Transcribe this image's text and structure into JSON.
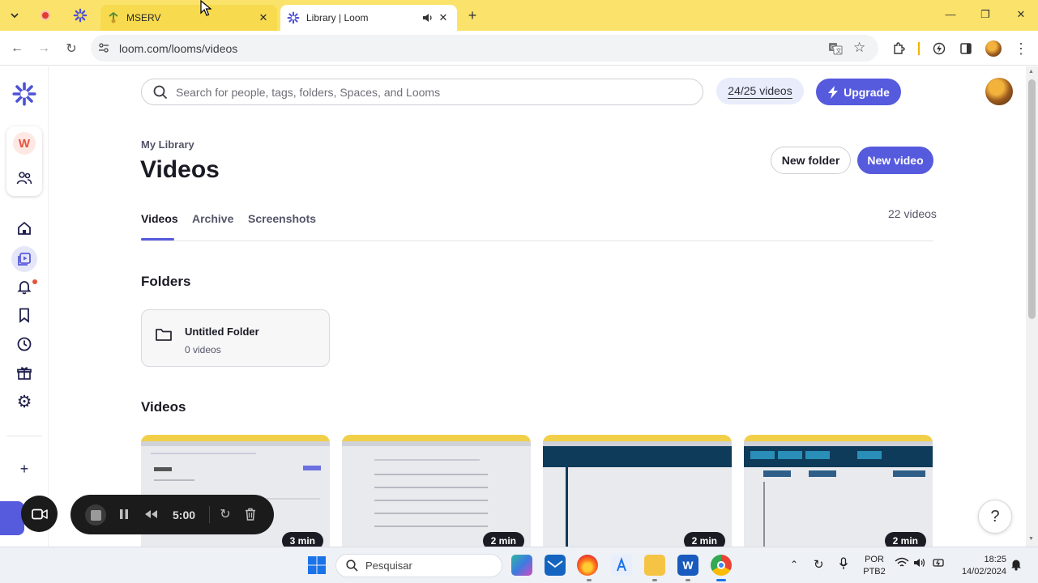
{
  "browser": {
    "tabs": [
      {
        "title": "MSERV",
        "close": "✕"
      },
      {
        "title": "Library | Loom",
        "close": "✕"
      }
    ],
    "new_tab": "+",
    "url": "loom.com/looms/videos"
  },
  "header": {
    "search_placeholder": "Search for people, tags, folders, Spaces, and Looms",
    "quota": "24/25 videos",
    "upgrade": "Upgrade"
  },
  "library": {
    "breadcrumb": "My Library",
    "title": "Videos",
    "new_folder": "New folder",
    "new_video": "New video",
    "tabs": [
      "Videos",
      "Archive",
      "Screenshots"
    ],
    "count": "22 videos"
  },
  "folders": {
    "heading": "Folders",
    "items": [
      {
        "name": "Untitled Folder",
        "count": "0 videos"
      }
    ]
  },
  "videos": {
    "heading": "Videos",
    "durations": [
      "3 min",
      "2 min",
      "2 min",
      "2 min"
    ]
  },
  "recorder": {
    "time": "5:00"
  },
  "help": "?",
  "taskbar": {
    "search": "Pesquisar",
    "lang": "POR",
    "layout": "PTB2",
    "time": "18:25",
    "date": "14/02/2024"
  },
  "colors": {
    "accent": "#565ADD",
    "tabbar": "#fbe36b",
    "badge": "#e5533d"
  }
}
